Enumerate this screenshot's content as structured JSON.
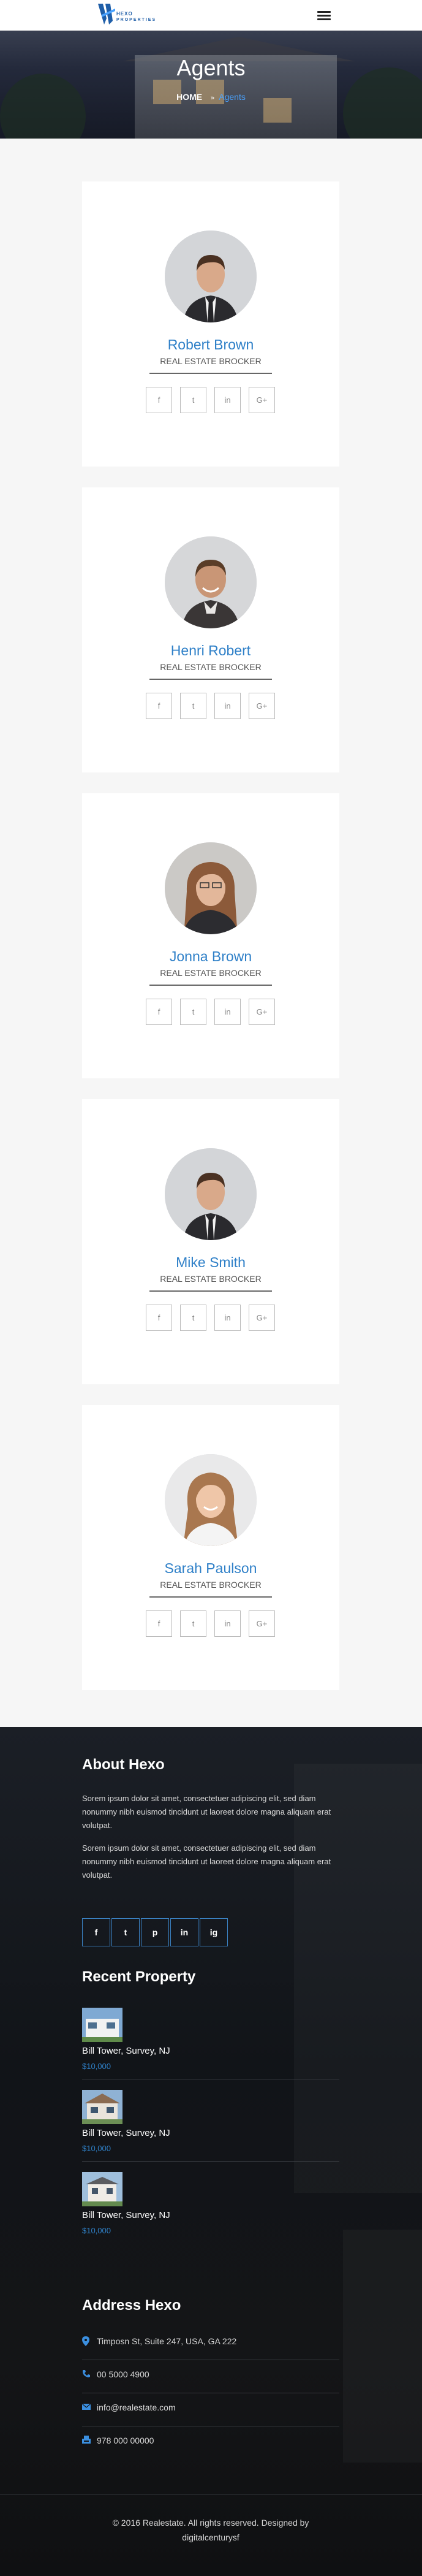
{
  "header": {
    "logo_text_1": "HEXO",
    "logo_text_2": "PROPERTIES",
    "menu_icon": "hamburger-menu-icon"
  },
  "banner": {
    "title": "Agents",
    "breadcrumb_home": "HOME",
    "breadcrumb_separator": "»",
    "breadcrumb_current": "Agents"
  },
  "agents": [
    {
      "name": "Robert Brown",
      "role": "REAL ESTATE BROCKER"
    },
    {
      "name": "Henri Robert",
      "role": "REAL ESTATE BROCKER"
    },
    {
      "name": "Jonna Brown",
      "role": "REAL ESTATE BROCKER"
    },
    {
      "name": "Mike Smith",
      "role": "REAL ESTATE BROCKER"
    },
    {
      "name": "Sarah Paulson",
      "role": "REAL ESTATE BROCKER"
    }
  ],
  "agent_socials": [
    "f",
    "t",
    "in",
    "G+"
  ],
  "footer": {
    "about_title": "About Hexo",
    "about_paragraph_1": "Sorem ipsum dolor sit amet, consectetuer adipiscing elit, sed diam nonummy nibh euismod tincidunt ut laoreet dolore magna aliquam erat volutpat.",
    "about_paragraph_2": "Sorem ipsum dolor sit amet, consectetuer adipiscing elit, sed diam nonummy nibh euismod tincidunt ut laoreet dolore magna aliquam erat volutpat.",
    "social_icons": [
      "f",
      "t",
      "p",
      "in",
      "ig"
    ],
    "recent_title": "Recent Property",
    "properties": [
      {
        "title": "Bill Tower, Survey, NJ",
        "price": "$10,000"
      },
      {
        "title": "Bill Tower, Survey, NJ",
        "price": "$10,000"
      },
      {
        "title": "Bill Tower, Survey, NJ",
        "price": "$10,000"
      }
    ],
    "address_title": "Address Hexo",
    "address": "Timposn St, Suite 247, USA, GA 222",
    "phone": "00 5000 4900",
    "email": "info@realestate.com",
    "fax": "978 000 00000",
    "copyright_line_1": "© 2016 Realestate. All rights reserved. Designed by",
    "copyright_line_2": "digitalcenturysf"
  },
  "colors": {
    "accent": "#2f80c8",
    "breadcrumb_current": "#4aa3ff",
    "footer_bg": "#141517"
  }
}
